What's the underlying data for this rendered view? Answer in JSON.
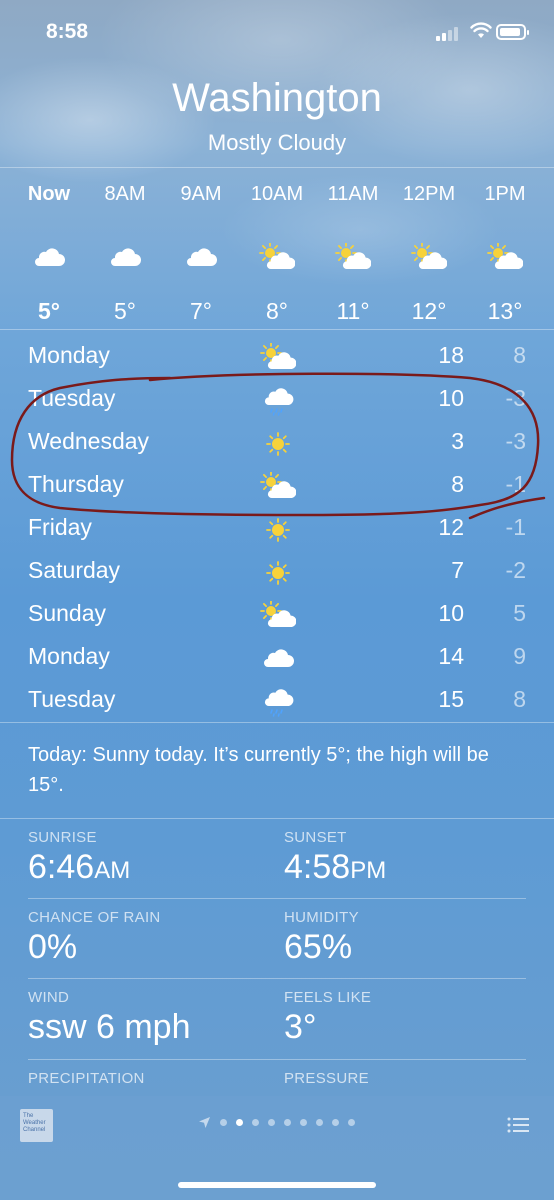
{
  "status_bar": {
    "time": "8:58"
  },
  "header": {
    "city": "Washington",
    "condition": "Mostly Cloudy"
  },
  "hourly": [
    {
      "label": "Now",
      "icon": "cloud-icon",
      "temp": "5°"
    },
    {
      "label": "8AM",
      "icon": "cloud-icon",
      "temp": "5°"
    },
    {
      "label": "9AM",
      "icon": "cloud-icon",
      "temp": "7°"
    },
    {
      "label": "10AM",
      "icon": "partly-cloudy-icon",
      "temp": "8°"
    },
    {
      "label": "11AM",
      "icon": "partly-cloudy-icon",
      "temp": "11°"
    },
    {
      "label": "12PM",
      "icon": "partly-cloudy-icon",
      "temp": "12°"
    },
    {
      "label": "1PM",
      "icon": "partly-cloudy-icon",
      "temp": "13°"
    }
  ],
  "daily": [
    {
      "day": "Monday",
      "icon": "partly-cloudy-icon",
      "high": "18",
      "low": "8"
    },
    {
      "day": "Tuesday",
      "icon": "rain-cloud-icon",
      "high": "10",
      "low": "-3"
    },
    {
      "day": "Wednesday",
      "icon": "sun-icon",
      "high": "3",
      "low": "-3"
    },
    {
      "day": "Thursday",
      "icon": "partly-cloudy-icon",
      "high": "8",
      "low": "-1"
    },
    {
      "day": "Friday",
      "icon": "sun-icon",
      "high": "12",
      "low": "-1"
    },
    {
      "day": "Saturday",
      "icon": "sun-icon",
      "high": "7",
      "low": "-2"
    },
    {
      "day": "Sunday",
      "icon": "partly-cloudy-icon",
      "high": "10",
      "low": "5"
    },
    {
      "day": "Monday",
      "icon": "cloud-icon",
      "high": "14",
      "low": "9"
    },
    {
      "day": "Tuesday",
      "icon": "rain-cloud-icon",
      "high": "15",
      "low": "8"
    }
  ],
  "summary": "Today: Sunny today. It’s currently 5°; the high will be 15°.",
  "details": {
    "sunrise": {
      "label": "SUNRISE",
      "value": "6:46",
      "suffix": "AM"
    },
    "sunset": {
      "label": "SUNSET",
      "value": "4:58",
      "suffix": "PM"
    },
    "chance_of_rain": {
      "label": "CHANCE OF RAIN",
      "value": "0%"
    },
    "humidity": {
      "label": "HUMIDITY",
      "value": "65%"
    },
    "wind": {
      "label": "WIND",
      "value": "ssw 6 mph"
    },
    "feels_like": {
      "label": "FEELS LIKE",
      "value": "3°"
    },
    "precipitation": {
      "label": "PRECIPITATION"
    },
    "pressure": {
      "label": "PRESSURE"
    }
  },
  "bottom_bar": {
    "provider_logo_text": "The Weather Channel",
    "page_count": 9,
    "active_page": 1
  },
  "colors": {
    "annotation_ink": "#7a1a1a",
    "sun_yellow": "#f7d23a"
  }
}
